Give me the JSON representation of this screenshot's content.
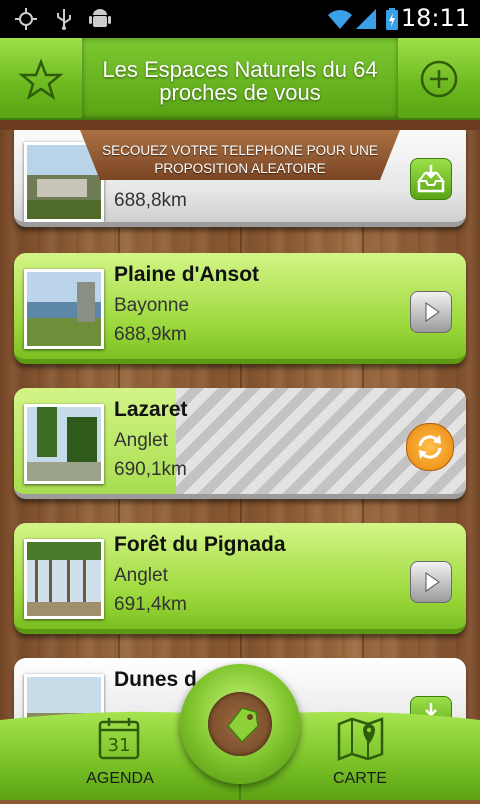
{
  "status_bar": {
    "time": "18:11"
  },
  "header": {
    "title_line1": "Les Espaces Naturels du 64",
    "title_line2": "proches de vous"
  },
  "banner": {
    "line1": "SECOUEZ VOTRE TELEPHONE POUR UNE",
    "line2": "PROPOSITION ALEATOIRE"
  },
  "list": {
    "items": [
      {
        "name": "",
        "city": "",
        "distance": "688,8km",
        "state": "partial"
      },
      {
        "name": "Plaine d'Ansot",
        "city": "Bayonne",
        "distance": "688,9km",
        "state": "play"
      },
      {
        "name": "Lazaret",
        "city": "Anglet",
        "distance": "690,1km",
        "state": "loading",
        "progress": 0.35
      },
      {
        "name": "Forêt du Pignada",
        "city": "Anglet",
        "distance": "691,4km",
        "state": "play"
      },
      {
        "name": "Dunes d",
        "city": "",
        "distance": "",
        "state": "partial"
      }
    ]
  },
  "bottom_bar": {
    "agenda_label": "AGENDA",
    "agenda_day": "31",
    "carte_label": "CARTE"
  },
  "colors": {
    "accent_green": "#7cbf23",
    "header_green": "#6cb81e",
    "loading_orange": "#f39a1e"
  }
}
